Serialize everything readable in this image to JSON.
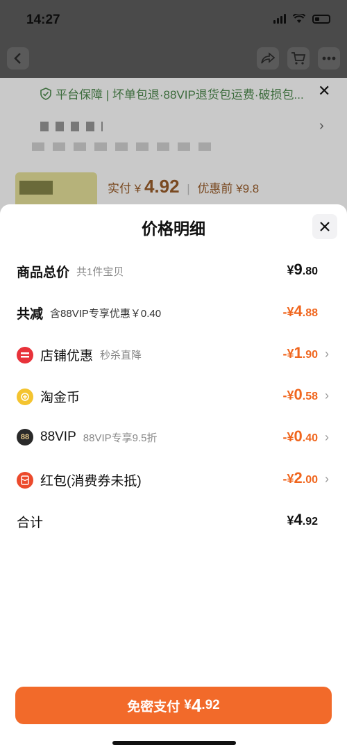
{
  "status_bar": {
    "time": "14:27"
  },
  "background": {
    "guarantee_text": "平台保障 | 坏单包退·88VIP退货包运费·破损包...",
    "pay_label": "实付",
    "pay_currency": "¥",
    "pay_amount": "4.92",
    "pre_discount": "优惠前 ¥9.8"
  },
  "sheet": {
    "title": "价格明细",
    "rows": [
      {
        "label": "商品总价",
        "sub": "共1件宝贝",
        "value_prefix": "¥",
        "value_int": "9",
        "value_dec": ".80"
      },
      {
        "label": "共减",
        "sub": "含88VIP专享优惠￥0.40",
        "value_prefix": "-¥",
        "value_int": "4",
        "value_dec": ".88"
      },
      {
        "label": "店铺优惠",
        "sub": "秒杀直降",
        "value_prefix": "-¥",
        "value_int": "1",
        "value_dec": ".90",
        "icon": "shop-discount-icon",
        "icon_color": "#e8323a"
      },
      {
        "label": "淘金币",
        "sub": "",
        "value_prefix": "-¥",
        "value_int": "0",
        "value_dec": ".58",
        "icon": "gold-coin-icon",
        "icon_color": "#f4c430"
      },
      {
        "label": "88VIP",
        "sub": "88VIP专享9.5折",
        "value_prefix": "-¥",
        "value_int": "0",
        "value_dec": ".40",
        "icon": "vip88-icon",
        "icon_color": "#2a2a2a"
      },
      {
        "label": "红包(消费券未抵)",
        "sub": "",
        "value_prefix": "-¥",
        "value_int": "2",
        "value_dec": ".00",
        "icon": "red-packet-icon",
        "icon_color": "#ec4a2c"
      },
      {
        "label": "合计",
        "sub": "",
        "value_prefix": "¥",
        "value_int": "4",
        "value_dec": ".92"
      }
    ],
    "vip_badge": "88"
  },
  "pay_button": {
    "label": "免密支付",
    "currency": "¥",
    "int": "4",
    "dec": ".92"
  },
  "colors": {
    "accent": "#f26a2a",
    "discount": "#f0661e"
  }
}
